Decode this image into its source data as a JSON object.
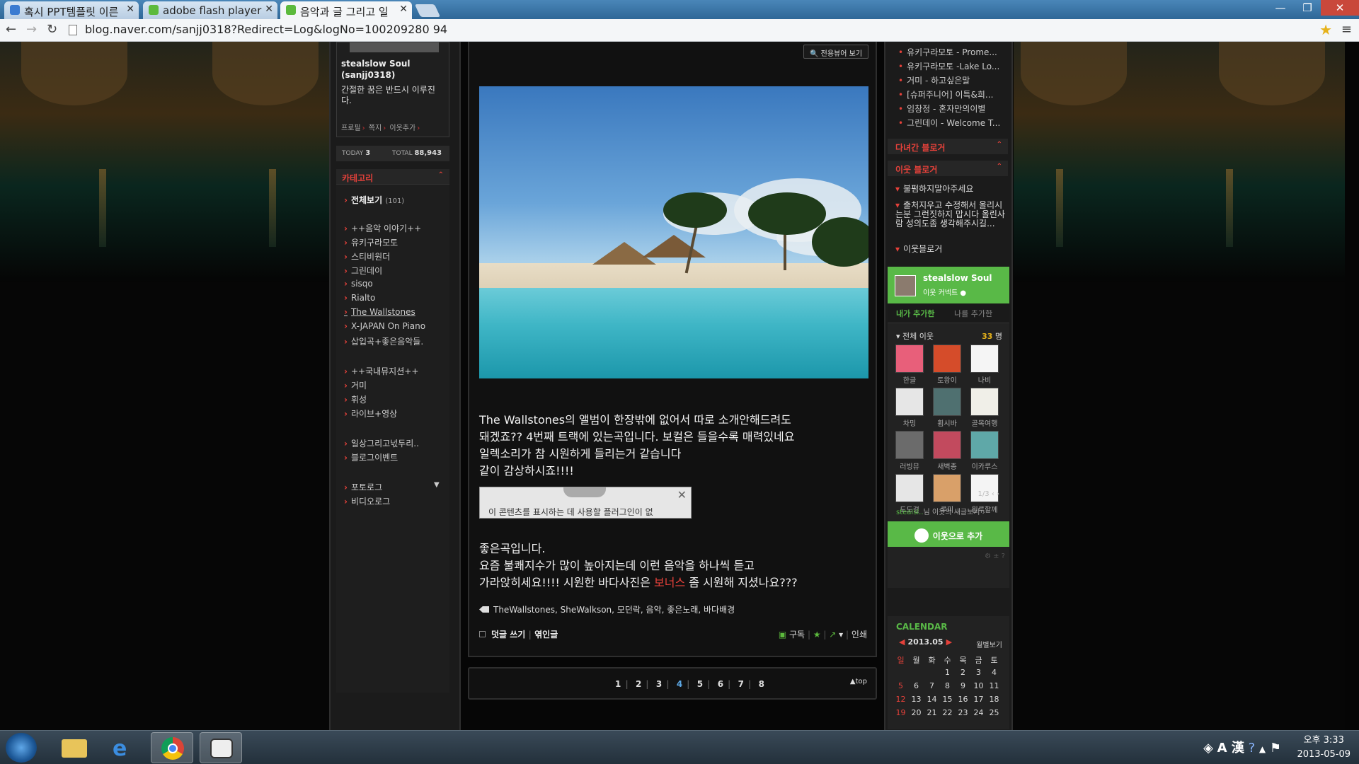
{
  "browser": {
    "tabs": [
      {
        "title": "혹시 PPT템플릿 이른",
        "color": "#3b7bd1"
      },
      {
        "title": "adobe flash player",
        "color": "#5cba3d"
      },
      {
        "title": "음악과 글 그리고 일",
        "color": "#5cba3d"
      }
    ],
    "url": "blog.naver.com/sanjj0318?Redirect=Log&logNo=100209280 94"
  },
  "profile": {
    "name": "stealslow Soul (sanjj0318)",
    "desc": "간절한 꿈은 반드시 이루진다.",
    "links": [
      "프로필",
      "쪽지",
      "이웃추가"
    ]
  },
  "counter": {
    "today_label": "TODAY",
    "today": "3",
    "total_label": "TOTAL",
    "total": "88,943"
  },
  "category": {
    "title": "카테고리",
    "all": "전체보기",
    "all_count": "(101)",
    "items": [
      "++음악 이야기++",
      "유키구라모토",
      "스티비원더",
      "그린데이",
      "sisqo",
      "Rialto",
      "The Wallstones",
      "X-JAPAN On Piano",
      "삽입곡+좋은음악들.",
      "++국내뮤지션++",
      "거미",
      "휘성",
      "라이브+영상",
      "일상그리고넋두리..",
      "블로그이벤트",
      "포토로그",
      "비디오로그"
    ]
  },
  "post": {
    "viewer_btn": "전용뷰어 보기",
    "para1": [
      "The Wallstones의  앨범이 한장밖에 없어서 따로 소개안해드려도",
      "돼겠죠?? 4번째 트랙에 있는곡입니다. 보컬은 들을수록 매력있네요",
      "일렉소리가 참 시원하게 들리는거 같습니다",
      "같이 감상하시죠!!!!"
    ],
    "plugin_msg": "이 콘텐츠를 표시하는 데 사용할 플러그인이 없",
    "para2": [
      "좋은곡입니다.",
      "요즘 불쾌지수가 많이 높아지는데 이런 음악을 하나씩 듣고"
    ],
    "para3_pre": "가라앉히세요!!!! 시원한 바다사진은 ",
    "para3_red": "보너스",
    "para3_post": " 좀 시원해 지셨나요???",
    "tags": "TheWallstones, SheWalkson, 모던락, 음악, 좋은노래, 바다배경",
    "comment": "덧글 쓰기",
    "trackback": "엮인글",
    "subscribe": "구독",
    "print": "인쇄",
    "pages": [
      "1",
      "2",
      "3",
      "4",
      "5",
      "6",
      "7",
      "8"
    ],
    "current_page": "4",
    "top": "▲top"
  },
  "right": {
    "recent": [
      "유키구라모토 - Prome...",
      "유키구라모토 -Lake Lo...",
      "거미 - 하고싶은말",
      "[슈퍼주니어] 이특&희...",
      "임창정 - 혼자만의이별",
      "그린데이 - Welcome T..."
    ],
    "visited_title": "다녀간 블로거",
    "neighbor_title": "이웃 블로거",
    "neighbor_items": [
      "불펌하지말아주세요",
      "출처지우고 수정해서 올리시는분 그런짓하지 맙시다 올린사람 성의도좀 생각해주시길...",
      "이웃블로거"
    ],
    "box": {
      "name": "stealslow Soul",
      "sub": "이웃 커넥트",
      "tab1": "내가 추가한",
      "tab2": "나를 추가한",
      "all": "전체 이웃",
      "count": "33",
      "count_unit": "명",
      "friends": [
        "한글",
        "토왕이",
        "나비",
        "차밍",
        "휩시바",
        "골목여행",
        "러빙뮤",
        "새벽종",
        "이카루스",
        "도도걸",
        "루피",
        "윌루할께"
      ],
      "page": "1/3",
      "link_pre": "stealsl..",
      "link_post": "님 이웃의 새글보기 ›",
      "add": "이웃으로 추가"
    },
    "calendar": {
      "title": "CALENDAR",
      "month": "2013.05",
      "view": "월별보기",
      "days": [
        "일",
        "월",
        "화",
        "수",
        "목",
        "금",
        "토"
      ],
      "rows": [
        [
          "",
          "",
          "",
          "1",
          "2",
          "3",
          "4"
        ],
        [
          "5",
          "6",
          "7",
          "8",
          "9",
          "10",
          "11"
        ],
        [
          "12",
          "13",
          "14",
          "15",
          "16",
          "17",
          "18"
        ],
        [
          "19",
          "20",
          "21",
          "22",
          "23",
          "24",
          "25"
        ]
      ]
    }
  },
  "taskbar": {
    "ampm": "오후 3:33",
    "date": "2013-05-09",
    "ime": "A 漢"
  }
}
